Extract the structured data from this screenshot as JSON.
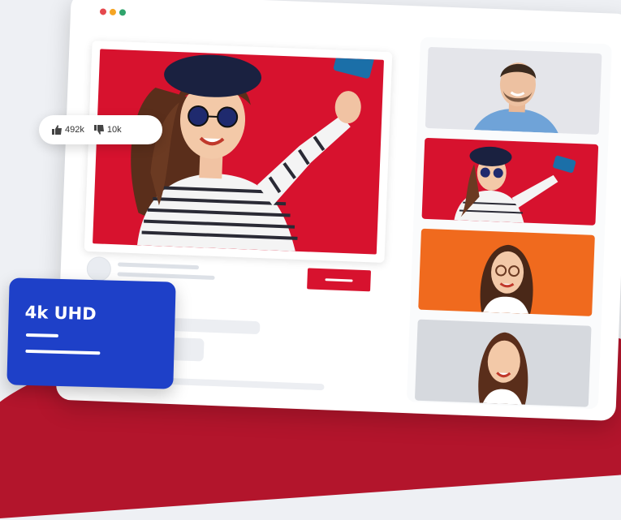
{
  "window": {
    "traffic_lights": [
      "#e5484d",
      "#f5a524",
      "#30a46c"
    ]
  },
  "main_video": {
    "background_color": "#d7122e"
  },
  "reactions": {
    "likes": "492k",
    "dislikes": "10k"
  },
  "badge": {
    "label": "4k UHD",
    "color": "#1e40c8"
  },
  "sidebar": {
    "thumbnails": [
      {
        "name": "man-smiling",
        "background": "#e4e5ea"
      },
      {
        "name": "woman-selfie",
        "background": "#d7122e"
      },
      {
        "name": "woman-glasses",
        "background": "#f06a1e"
      },
      {
        "name": "woman-smiling",
        "background": "#d6d9de"
      }
    ]
  },
  "colors": {
    "accent_red": "#d7122e",
    "brand_blue": "#1e40c8"
  }
}
